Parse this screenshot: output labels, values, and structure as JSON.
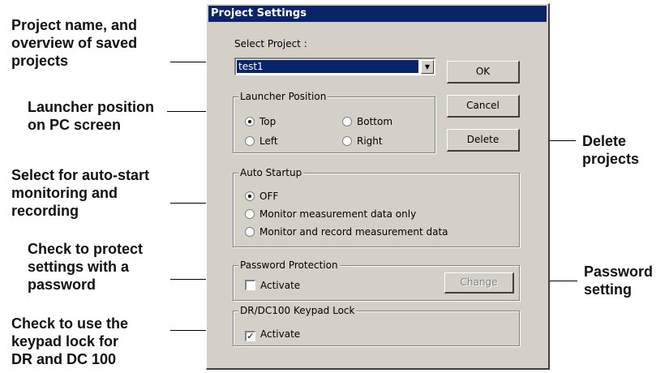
{
  "callouts": {
    "project_name": [
      "Project name, and",
      "overview of saved",
      "projects"
    ],
    "launcher": [
      "Launcher position",
      "on PC screen"
    ],
    "autostart": [
      "Select for auto-start",
      "monitoring and",
      "recording"
    ],
    "password_protect": [
      "Check to protect",
      "settings with a",
      "password"
    ],
    "keypad": [
      "Check to use the",
      "keypad lock for",
      "DR and DC 100"
    ],
    "delete": [
      "Delete",
      "projects"
    ],
    "password_setting": [
      "Password",
      "setting"
    ]
  },
  "dialog": {
    "title": "Project Settings",
    "select_project_label": "Select Project :",
    "project_value": "test1",
    "buttons": {
      "ok": "OK",
      "cancel": "Cancel",
      "delete": "Delete",
      "change": "Change"
    },
    "launcher_position": {
      "title": "Launcher Position",
      "top": "Top",
      "bottom": "Bottom",
      "left": "Left",
      "right": "Right",
      "selected": "Top"
    },
    "auto_startup": {
      "title": "Auto Startup",
      "off": "OFF",
      "monitor_only": "Monitor measurement data only",
      "monitor_record": "Monitor and record measurement data",
      "selected": "OFF"
    },
    "password_protection": {
      "title": "Password Protection",
      "activate": "Activate",
      "checked": false
    },
    "keypad_lock": {
      "title": "DR/DC100 Keypad Lock",
      "activate": "Activate",
      "checked": true
    }
  },
  "icons": {
    "dropdown": "chevron-down-icon",
    "radio": "radio-icon",
    "checkbox": "checkbox-icon"
  },
  "colors": {
    "titlebar": "#0a246a",
    "dialog_bg": "#d4d0c8",
    "selection": "#0a246a"
  }
}
